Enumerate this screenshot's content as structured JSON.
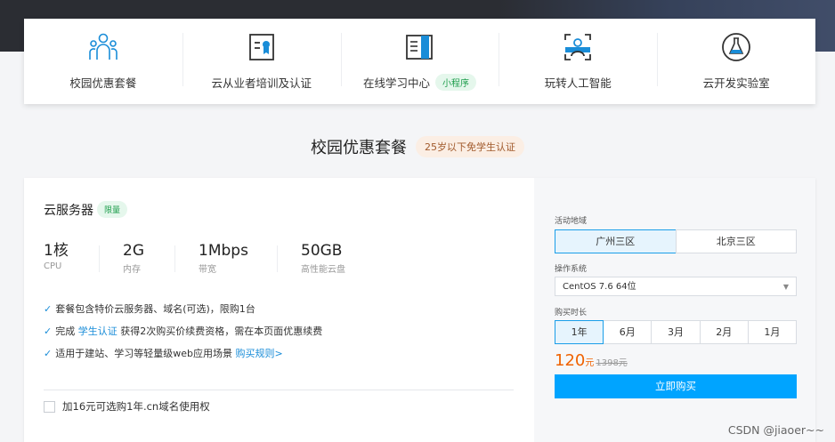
{
  "nav": {
    "items": [
      {
        "label": "校园优惠套餐",
        "icon": "people-group-icon"
      },
      {
        "label": "云从业者培训及认证",
        "icon": "certificate-icon"
      },
      {
        "label": "在线学习中心",
        "icon": "book-icon",
        "badge": "小程序"
      },
      {
        "label": "玩转人工智能",
        "icon": "face-scan-icon"
      },
      {
        "label": "云开发实验室",
        "icon": "flask-icon"
      }
    ]
  },
  "section": {
    "title": "校园优惠套餐",
    "tag": "25岁以下免学生认证"
  },
  "product": {
    "name": "云服务器",
    "badge": "限量",
    "specs": [
      {
        "value": "1核",
        "label": "CPU"
      },
      {
        "value": "2G",
        "label": "内存"
      },
      {
        "value": "1Mbps",
        "label": "带宽"
      },
      {
        "value": "50GB",
        "label": "高性能云盘"
      }
    ],
    "bullets": {
      "b1": "套餐包含特价云服务器、域名(可选)，限购1台",
      "b2_pre": "完成 ",
      "b2_link": "学生认证",
      "b2_post": " 获得2次购买价续费资格，需在本页面优惠续费",
      "b3_pre": "适用于建站、学习等轻量级web应用场景 ",
      "b3_link": "购买规则>"
    },
    "addon": "加16元可选购1年.cn域名使用权"
  },
  "purchase": {
    "region_label": "活动地域",
    "regions": [
      "广州三区",
      "北京三区"
    ],
    "selected_region": "广州三区",
    "os_label": "操作系统",
    "os_value": "CentOS 7.6 64位",
    "duration_label": "购买时长",
    "durations": [
      "1年",
      "6月",
      "3月",
      "2月",
      "1月"
    ],
    "selected_duration": "1年",
    "price": "120",
    "price_unit": "元",
    "original_price": "1398元",
    "buy_label": "立即购买"
  },
  "colors": {
    "accent": "#00a4ff",
    "price": "#f06200",
    "badge_green": "#1d9d4b"
  },
  "watermark": "CSDN @jiaoer~~"
}
